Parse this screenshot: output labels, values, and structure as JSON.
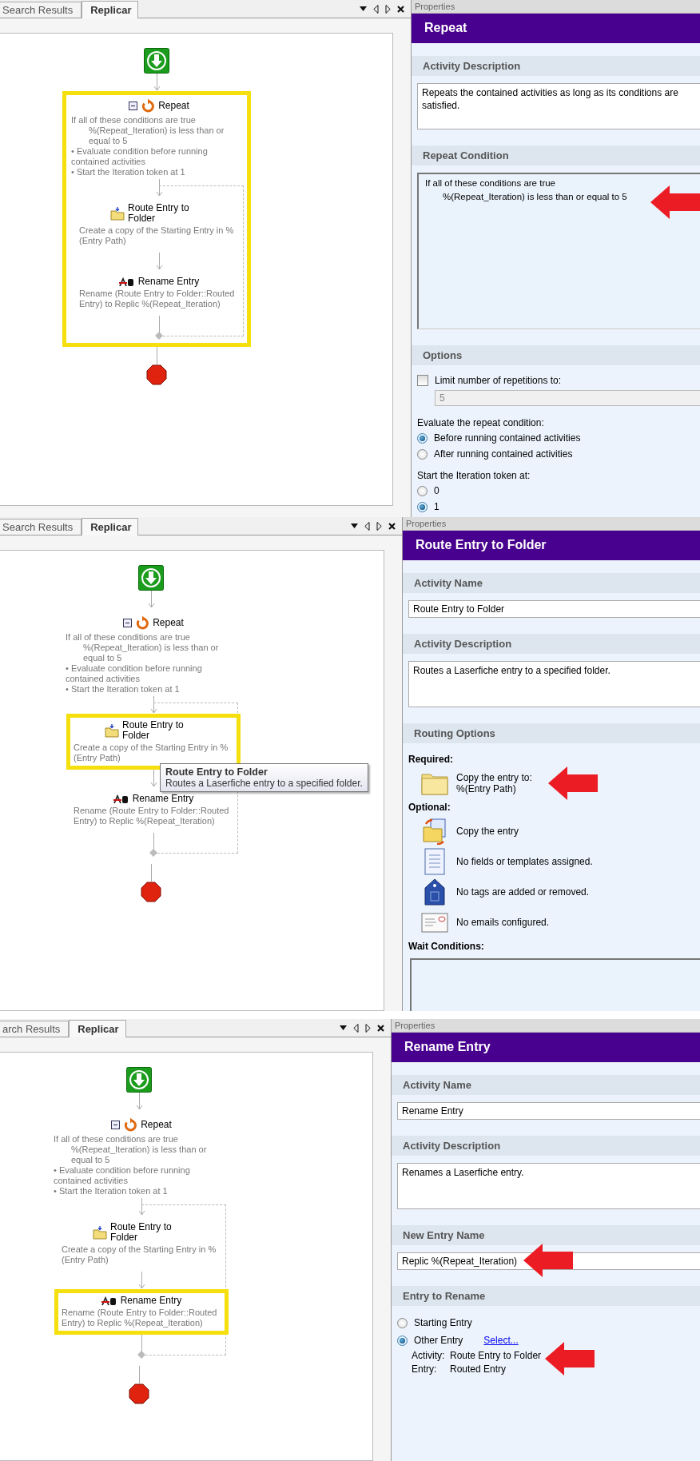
{
  "screens": [
    {
      "designer": {
        "tabs": [
          {
            "label": "Search Results",
            "selected": false
          },
          {
            "label": "Replicar",
            "selected": true
          }
        ],
        "activities": [
          {
            "kind": "start"
          },
          {
            "kind": "repeat",
            "title": "Repeat",
            "selected": true,
            "expanded": true,
            "lines": [
              {
                "kind": "heading",
                "text": "If all of these conditions are true"
              },
              {
                "kind": "condition",
                "text": "%(Repeat_Iteration) is less than or equal to 5"
              },
              {
                "kind": "bullet",
                "text": "• Evaluate condition before running contained activities"
              },
              {
                "kind": "bullet",
                "text": "• Start the Iteration token at 1"
              }
            ],
            "children": [
              {
                "kind": "route",
                "title": "Route Entry to Folder",
                "description": "Create a copy of the Starting Entry in %(Entry Path)",
                "selected": false
              },
              {
                "kind": "rename",
                "title": "Rename Entry",
                "description": "Rename (Route Entry to Folder::Routed Entry) to Replic %(Repeat_Iteration)",
                "selected": false
              }
            ]
          },
          {
            "kind": "end"
          }
        ]
      },
      "properties": {
        "header": "Properties",
        "title": "Repeat",
        "sections": [
          {
            "heading": "Activity Description",
            "items": [
              {
                "kind": "textarea",
                "value": "Repeats the contained activities as long as its conditions are satisfied."
              }
            ]
          },
          {
            "heading": "Repeat Condition",
            "items": [
              {
                "kind": "condition",
                "annotated": true,
                "lines": [
                  {
                    "kind": "heading",
                    "text": "If all of these conditions are true"
                  },
                  {
                    "kind": "condition",
                    "text": "%(Repeat_Iteration) is less than or equal to 5"
                  }
                ]
              }
            ]
          },
          {
            "heading": "Options",
            "items": [
              {
                "kind": "checkbox",
                "label": "Limit number of repetitions to:",
                "checked": false
              },
              {
                "kind": "number_field",
                "value": "5",
                "disabled": true
              },
              {
                "kind": "label",
                "text": "Evaluate the repeat condition:"
              },
              {
                "kind": "radio",
                "label": "Before running contained activities",
                "selected": true
              },
              {
                "kind": "radio",
                "label": "After running contained activities",
                "selected": false
              },
              {
                "kind": "label",
                "text": "Start the Iteration token at:"
              },
              {
                "kind": "radio",
                "label": "0",
                "selected": false
              },
              {
                "kind": "radio",
                "label": "1",
                "selected": true
              }
            ]
          }
        ]
      }
    },
    {
      "designer": {
        "tabs": [
          {
            "label": "Search Results",
            "selected": false
          },
          {
            "label": "Replicar",
            "selected": true
          }
        ],
        "activities": [
          {
            "kind": "start"
          },
          {
            "kind": "repeat",
            "title": "Repeat",
            "selected": false,
            "expanded": true,
            "lines": [
              {
                "kind": "heading",
                "text": "If all of these conditions are true"
              },
              {
                "kind": "condition",
                "text": "%(Repeat_Iteration) is less than or equal to 5"
              },
              {
                "kind": "bullet",
                "text": "• Evaluate condition before running contained activities"
              },
              {
                "kind": "bullet",
                "text": "• Start the Iteration token at 1"
              }
            ],
            "children": [
              {
                "kind": "route",
                "title": "Route Entry to Folder",
                "description": "Create a copy of the Starting Entry in %(Entry Path)",
                "selected": true,
                "tooltip": {
                  "title": "Route Entry to Folder",
                  "text": "Routes a Laserfiche entry to a specified folder."
                }
              },
              {
                "kind": "rename",
                "title": "Rename Entry",
                "description": "Rename (Route Entry to Folder::Routed Entry) to Replic %(Repeat_Iteration)",
                "selected": false
              }
            ]
          },
          {
            "kind": "end"
          }
        ]
      },
      "properties": {
        "header": "Properties",
        "title": "Route Entry to Folder",
        "sections": [
          {
            "heading": "Activity Name",
            "items": [
              {
                "kind": "textfield",
                "value": "Route Entry to Folder"
              }
            ]
          },
          {
            "heading": "Activity Description",
            "items": [
              {
                "kind": "textarea",
                "value": "Routes a Laserfiche entry to a specified folder."
              }
            ]
          },
          {
            "heading": "Routing Options",
            "items": [
              {
                "kind": "group_label",
                "text": "Required:"
              },
              {
                "kind": "folder_option",
                "annotated": true,
                "lines": [
                  "Copy the entry to:",
                  "%(Entry Path)"
                ]
              },
              {
                "kind": "group_label",
                "text": "Optional:"
              },
              {
                "kind": "copy_option",
                "lines": [
                  "Copy the entry"
                ]
              },
              {
                "kind": "document_option",
                "lines": [
                  "No fields or templates assigned."
                ]
              },
              {
                "kind": "tag_option",
                "lines": [
                  "No tags are added or removed."
                ]
              },
              {
                "kind": "email_option",
                "lines": [
                  "No emails configured."
                ]
              },
              {
                "kind": "group_label",
                "text": "Wait Conditions:"
              },
              {
                "kind": "listbox"
              }
            ]
          }
        ]
      }
    },
    {
      "designer": {
        "tabs": [
          {
            "label": "arch Results",
            "selected": false
          },
          {
            "label": "Replicar",
            "selected": true
          }
        ],
        "activities": [
          {
            "kind": "start"
          },
          {
            "kind": "repeat",
            "title": "Repeat",
            "selected": false,
            "expanded": true,
            "lines": [
              {
                "kind": "heading",
                "text": "If all of these conditions are true"
              },
              {
                "kind": "condition",
                "text": "%(Repeat_Iteration) is less than or equal to 5"
              },
              {
                "kind": "bullet",
                "text": "• Evaluate condition before running contained activities"
              },
              {
                "kind": "bullet",
                "text": "• Start the Iteration token at 1"
              }
            ],
            "children": [
              {
                "kind": "route",
                "title": "Route Entry to Folder",
                "description": "Create a copy of the Starting Entry in %(Entry Path)",
                "selected": false
              },
              {
                "kind": "rename",
                "title": "Rename Entry",
                "description": "Rename (Route Entry to Folder::Routed Entry) to Replic %(Repeat_Iteration)",
                "selected": true
              }
            ]
          },
          {
            "kind": "end"
          }
        ]
      },
      "properties": {
        "header": "Properties",
        "title": "Rename Entry",
        "sections": [
          {
            "heading": "Activity Name",
            "items": [
              {
                "kind": "textfield",
                "value": "Rename Entry"
              }
            ]
          },
          {
            "heading": "Activity Description",
            "items": [
              {
                "kind": "textarea",
                "value": "Renames a Laserfiche entry."
              }
            ]
          },
          {
            "heading": "New Entry Name",
            "items": [
              {
                "kind": "textfield",
                "value": "Replic %(Repeat_Iteration)",
                "annotated": true
              }
            ]
          },
          {
            "heading": "Entry to Rename",
            "items": [
              {
                "kind": "radio",
                "label": "Starting Entry",
                "selected": false
              },
              {
                "kind": "radio",
                "label": "Other Entry",
                "selected": true,
                "link": "Select..."
              },
              {
                "kind": "detail",
                "annotated": true,
                "rows": [
                  {
                    "label": "Activity:",
                    "value": "Route Entry to Folder"
                  },
                  {
                    "label": "Entry:",
                    "value": "Routed Entry"
                  }
                ]
              }
            ]
          }
        ]
      }
    }
  ]
}
